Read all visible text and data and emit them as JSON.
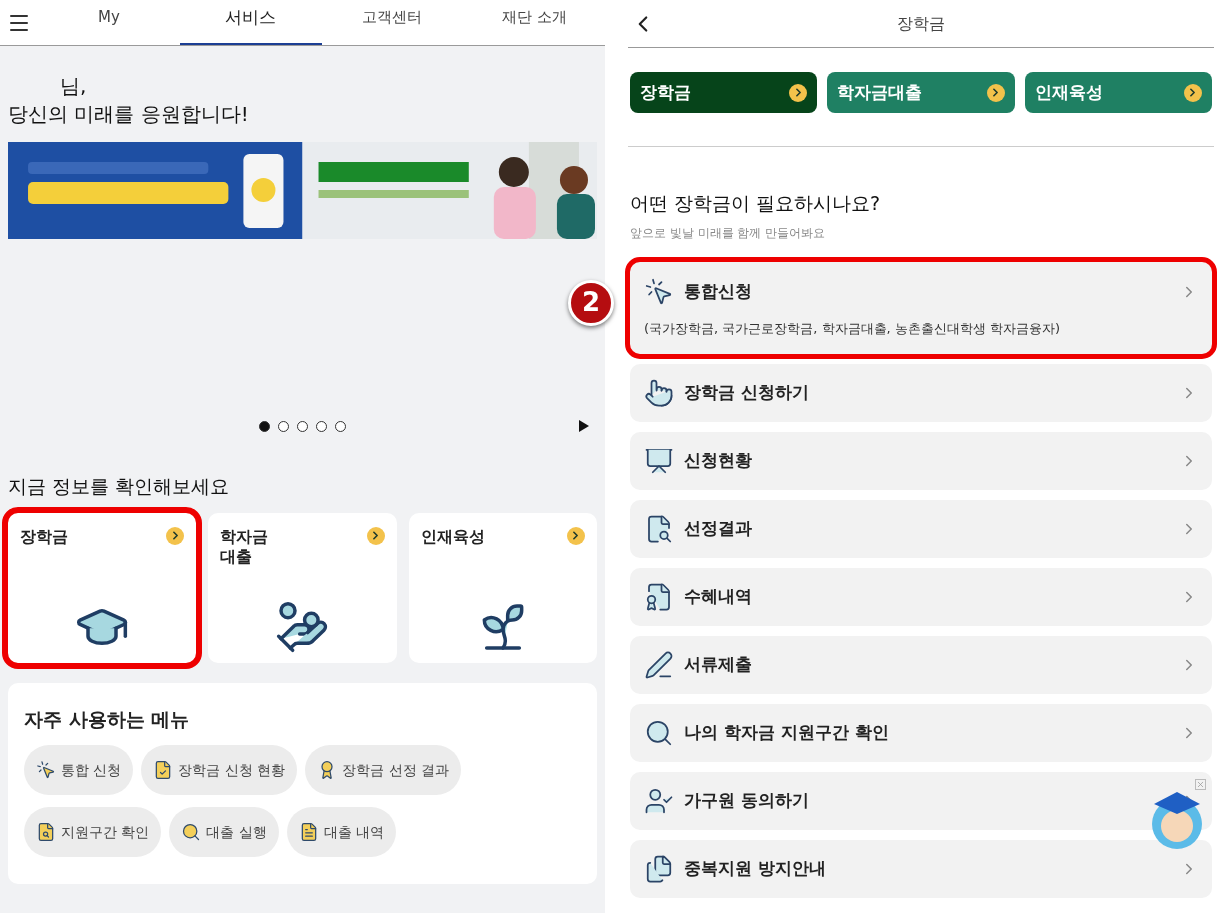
{
  "left": {
    "tabs": [
      {
        "label": "My",
        "selected": false
      },
      {
        "label": "서비스",
        "selected": true
      },
      {
        "label": "고객센터",
        "selected": false
      },
      {
        "label": "재단 소개",
        "selected": false
      }
    ],
    "greeting": {
      "name_line": "님,",
      "line": "당신의 미래를 응원합니다!"
    },
    "carousel": {
      "dots": [
        {
          "selected": true
        },
        {
          "selected": false
        },
        {
          "selected": false
        },
        {
          "selected": false
        },
        {
          "selected": false
        }
      ]
    },
    "info_heading": "지금 정보를 확인해보세요",
    "cards": [
      {
        "lines": [
          "장학금"
        ],
        "highlighted": true
      },
      {
        "lines": [
          "학자금",
          "대출"
        ],
        "highlighted": false
      },
      {
        "lines": [
          "인재육성"
        ],
        "highlighted": false
      }
    ],
    "frequent_menu": {
      "title": "자주 사용하는 메뉴",
      "items": [
        "통합 신청",
        "장학금 신청 현황",
        "장학금 선정 결과",
        "지원구간 확인",
        "대출 실행",
        "대출 내역"
      ]
    }
  },
  "right": {
    "title": "장학금",
    "tabs": [
      {
        "label": "장학금",
        "selected": true
      },
      {
        "label": "학자금대출",
        "selected": false
      },
      {
        "label": "인재육성",
        "selected": false
      }
    ],
    "heading": "어떤 장학금이 필요하시나요?",
    "subheading": "앞으로 빛날 미래를 함께 만들어봐요",
    "step_badge": "2",
    "items": [
      {
        "label": "통합신청",
        "note": "(국가장학금, 국가근로장학금, 학자금대출, 농촌출신대학생 학자금융자)",
        "highlighted": true
      },
      {
        "label": "장학금 신청하기",
        "highlighted": false
      },
      {
        "label": "신청현황",
        "highlighted": false
      },
      {
        "label": "선정결과",
        "highlighted": false
      },
      {
        "label": "수혜내역",
        "highlighted": false
      },
      {
        "label": "서류제출",
        "highlighted": false
      },
      {
        "label": "나의 학자금 지원구간 확인",
        "highlighted": false
      },
      {
        "label": "가구원 동의하기",
        "highlighted": false
      },
      {
        "label": "중복지원 방지안내",
        "highlighted": false
      }
    ]
  }
}
